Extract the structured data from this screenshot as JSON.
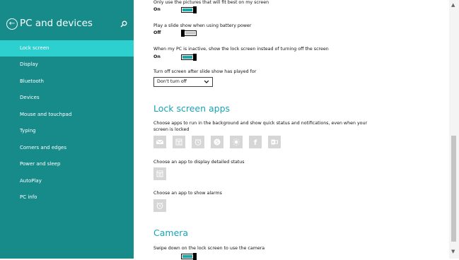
{
  "sidebar": {
    "title": "PC and devices",
    "back_icon": "back-arrow-icon",
    "search_icon": "search-icon",
    "items": [
      {
        "label": "Lock screen",
        "selected": true
      },
      {
        "label": "Display"
      },
      {
        "label": "Bluetooth"
      },
      {
        "label": "Devices"
      },
      {
        "label": "Mouse and touchpad"
      },
      {
        "label": "Typing"
      },
      {
        "label": "Corners and edges"
      },
      {
        "label": "Power and sleep"
      },
      {
        "label": "AutoPlay"
      },
      {
        "label": "PC info"
      }
    ]
  },
  "content": {
    "setting1": {
      "label": "Only use the pictures that will fit best on my screen",
      "state": "On"
    },
    "setting2": {
      "label": "Play a slide show when using battery power",
      "state": "Off"
    },
    "setting3": {
      "label": "When my PC is inactive, show the lock screen instead of turning off the screen",
      "state": "On"
    },
    "turnoff": {
      "label": "Turn off screen after slide show has played for",
      "value": "Don't turn off"
    },
    "lock_apps": {
      "heading": "Lock screen apps",
      "desc_line1": "Choose apps to run in the background and show quick status and notifications, even when your",
      "desc_line2": "screen is locked",
      "apps": [
        "mail-icon",
        "calendar-icon",
        "alarm-icon",
        "skype-icon",
        "weather-icon",
        "facebook-icon",
        "outlook-icon"
      ],
      "detailed_label": "Choose an app to display detailed status",
      "detailed_app": "calendar-icon",
      "alarm_label": "Choose an app to show alarms",
      "alarm_app": "alarm-icon"
    },
    "camera": {
      "heading": "Camera",
      "label": "Swipe down on the lock screen to use the camera"
    }
  },
  "colors": {
    "sidebar_bg": "#178a8a",
    "selected_bg": "#2dcfcf",
    "accent": "#18a3b5",
    "toggle_on": "#17a9a9"
  }
}
